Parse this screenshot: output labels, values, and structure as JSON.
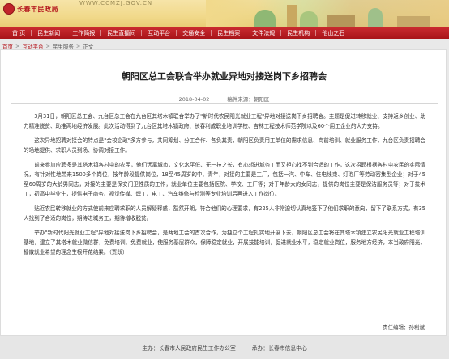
{
  "site": {
    "logo_text": "长春市民政局",
    "url": "WWW.CCMZJ.GOV.CN"
  },
  "nav": [
    "首 页",
    "民生新闻",
    "工作简报",
    "民生直播间",
    "互动平台",
    "交通安全",
    "民生档案",
    "文件法规",
    "民生机构",
    "他山之石"
  ],
  "breadcrumb": {
    "home": "首页",
    "level1": "互动平台",
    "level2": "民生服务",
    "current": "正文",
    "separator": ">"
  },
  "article": {
    "title": "朝阳区总工会联合举办就业异地对接送岗下乡招聘会",
    "date": "2018-04-02",
    "source_label": "稿件来源：",
    "source": "朝阳区",
    "paragraphs": [
      "3月31日，朝阳区总工会、九台区总工会在九台区其塔木镇联合举办了\"新时代农民阳光就业工程\"异地对接送岗下乡招聘会。主题是促进转移就业、支持返乡创业、助力精准脱贫、助推两地经济发展。此次活动得到了九台区其塔木镇政府、长春利成职业培训学校、吉林工程技术师范学院以及60个用工企业的大力支持。",
      "这次异地招聘对接会的特点是\"会校企政\"多方参与，共同筹划、分工合作、各负其责，朝阳区负责用工单位的需求信息、岗前培训、就业服务工作，九台区负责招聘会的场地提供、求职人员到场、协调对接工作。",
      "前来参加应聘多是其塔木镇各村屯的农民，他们远离城市，文化水平低、无一技之长，有心想进城务工而又担心找不到合适的工作，这次招聘根据各村屯农民的实际情况，有针对性地带来1500多个岗位，按年龄段提供岗位，18至45周岁的中、青年，对接的主要是工厂，包括一汽、中车、住电线束、灯泡厂等劳动密集型企业；对于45至60周岁的大龄男同志，对接的主要是保安门卫性质的工作，就业单位主要包括医院、学校、工厂等；对于年龄大的女同志，提供的岗位主要是保洁服务员等；对于技术工，初高中毕业生，提供电子商务、视觉传媒、焊工、电工、汽车维修与检测等专业培训后再进入工作岗位。",
      "贴近农民转移就业的方式使前来应聘求职的人员解疑释惑，豁然开朗，符合他们的心理要求，有225人非常迫切认真地签下了他们求职的意向，留下了联系方式，有35人找到了合适的岗位，期待进城务工，期待增收脱贫。",
      "举办\"新时代阳光就业工程\"异地对接送岗下乡招聘会，是两地工会的首次合作，为独立个工程扎实地开展下去，朝阳区总工会将在其塔木镇建立农民阳光就业工程培训基地，建立了其塔木就业微信群，免费培训、免费就业，使服务基层群众，保障稳定就业，开展技能培训，促进就业水平，稳定就业岗位，服务地方经济，本当政府阳光，播散就业希望的理念生根开花结果。（贾跃）"
    ],
    "editor_label": "责任编辑：",
    "editor": "孙利斌"
  },
  "footer": {
    "host": "主办：长春市人民政府民生工作办公室",
    "organizer": "承办：长春市信息中心"
  }
}
